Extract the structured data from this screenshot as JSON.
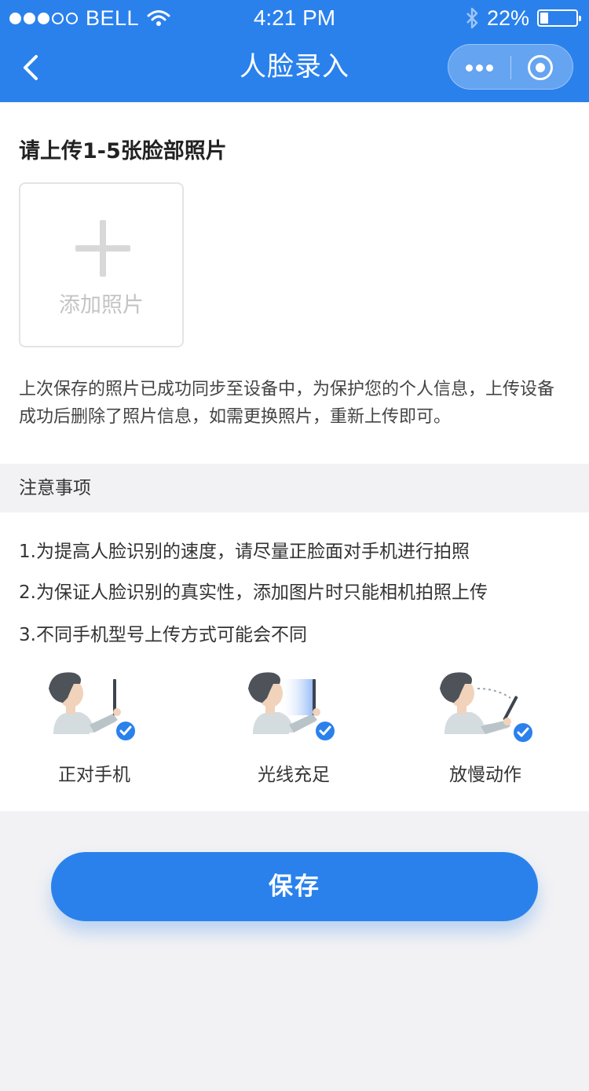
{
  "status_bar": {
    "carrier": "BELL",
    "time": "4:21 PM",
    "battery_percent": "22%",
    "battery_level": 0.22,
    "icons": [
      "signal-dots-icon",
      "wifi-icon",
      "bluetooth-icon",
      "battery-icon"
    ]
  },
  "nav": {
    "title": "人脸录入",
    "back_icon": "chevron-left-icon",
    "more_icon": "more-dots-icon",
    "close_icon": "target-circle-icon"
  },
  "upload": {
    "title": "请上传1-5张脸部照片",
    "add_label": "添加照片",
    "add_icon": "plus-icon",
    "note": "上次保存的照片已成功同步至设备中，为保护您的个人信息，上传设备成功后删除了照片信息，如需更换照片，重新上传即可。"
  },
  "notice": {
    "heading": "注意事项",
    "items": [
      "1.为提高人脸识别的速度，请尽量正脸面对手机进行拍照",
      "2.为保证人脸识别的真实性，添加图片时只能相机拍照上传",
      "3.不同手机型号上传方式可能会不同"
    ],
    "tips": [
      {
        "label": "正对手机",
        "icon": "face-phone-illustration"
      },
      {
        "label": "光线充足",
        "icon": "light-phone-illustration"
      },
      {
        "label": "放慢动作",
        "icon": "slow-move-illustration"
      }
    ]
  },
  "actions": {
    "save_label": "保存"
  },
  "colors": {
    "primary": "#2a81ec",
    "check": "#2a81ec",
    "background": "#f2f2f4"
  }
}
